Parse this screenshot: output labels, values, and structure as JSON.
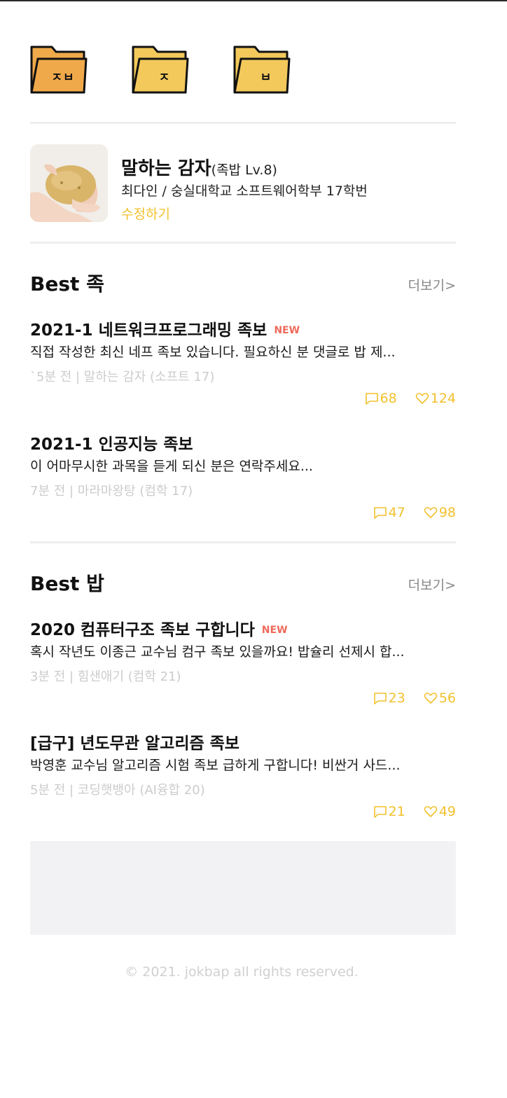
{
  "folders": [
    {
      "label": "ㅈㅂ",
      "color": "#f0a94a"
    },
    {
      "label": "ㅈ",
      "color": "#f3c95c"
    },
    {
      "label": "ㅂ",
      "color": "#f3c95c"
    }
  ],
  "profile": {
    "nickname": "말하는 감자",
    "level": "(족밥 Lv.8)",
    "info": "최다인 / 숭실대학교 소프트웨어학부 17학번",
    "edit_label": "수정하기"
  },
  "sections": [
    {
      "title": "Best 족",
      "more": "더보기>",
      "posts": [
        {
          "title": "2021-1 네트워크프로그래밍 족보",
          "badge": "NEW",
          "preview": "직접 작성한 최신 네프 족보 있습니다. 필요하신 분 댓글로 밥 제...",
          "meta": "`5분 전 | 말하는 감자 (소프트 17)",
          "comments": "68",
          "likes": "124"
        },
        {
          "title": "2021-1 인공지능 족보",
          "badge": "",
          "preview": "이 어마무시한 과목을 듣게 되신 분은 연락주세요...",
          "meta": "7분 전 | 마라마왕탕 (컴학 17)",
          "comments": "47",
          "likes": "98"
        }
      ]
    },
    {
      "title": "Best 밥",
      "more": "더보기>",
      "posts": [
        {
          "title": "2020 컴퓨터구조 족보 구합니다",
          "badge": "NEW",
          "preview": "혹시 작년도 이종근 교수님 컴구 족보 있을까요! 밥슐리 선제시 합...",
          "meta": "3분 전 | 힘샌애기 (컴학 21)",
          "comments": "23",
          "likes": "56"
        },
        {
          "title": "[급구] 년도무관 알고리즘 족보",
          "badge": "",
          "preview": "박영훈 교수님 알고리즘 시험 족보 급하게 구합니다! 비싼거 사드...",
          "meta": "5분 전 | 코딩햇뱅아 (AI융합 20)",
          "comments": "21",
          "likes": "49"
        }
      ]
    }
  ],
  "footer": "© 2021. jokbap all rights reserved.",
  "colors": {
    "accent": "#f2c12e",
    "new_badge": "#ef6a5b",
    "folder_dark": "#f0a94a",
    "folder_light": "#f3c95c"
  },
  "icons": {
    "comment": "comment-icon",
    "like": "heart-icon",
    "folder": "folder-icon"
  }
}
